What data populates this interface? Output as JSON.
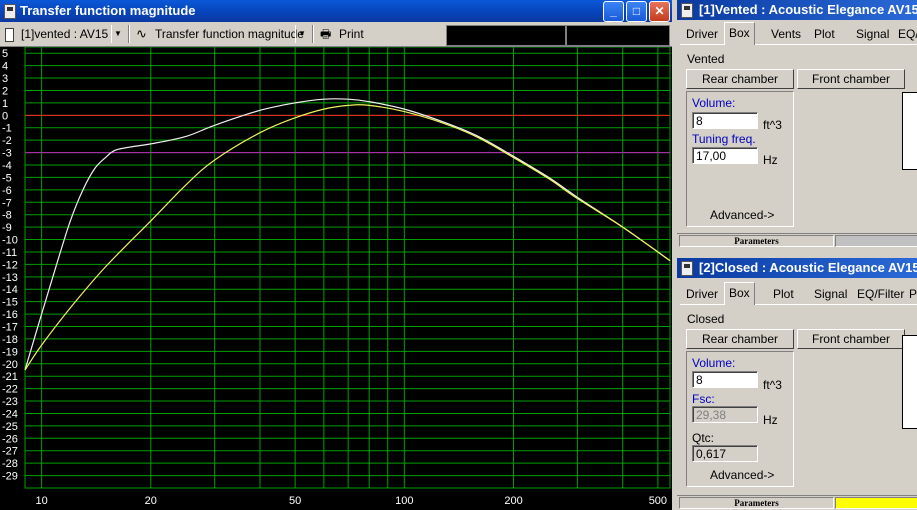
{
  "main_window": {
    "title": "Transfer function magnitude",
    "buttons": {
      "minimize": "_",
      "maximize": "□",
      "close": "✕"
    }
  },
  "toolbar": {
    "driver_select": "[1]vented : AV15",
    "plot_select": "Transfer function magnitude",
    "plot_icon": "sine-wave-icon",
    "print_label": "Print"
  },
  "chart_data": {
    "type": "line",
    "xscale": "log",
    "xlim": [
      9,
      540
    ],
    "ylim": [
      -30,
      5.5
    ],
    "grid": true,
    "y_ticks": [
      5,
      4,
      3,
      2,
      1,
      0,
      -1,
      -2,
      -3,
      -4,
      -5,
      -6,
      -7,
      -8,
      -9,
      -10,
      -11,
      -12,
      -13,
      -14,
      -15,
      -16,
      -17,
      -18,
      -19,
      -20,
      -21,
      -22,
      -23,
      -24,
      -25,
      -26,
      -27,
      -28,
      -29
    ],
    "x_tick_labels": [
      {
        "value": 10,
        "label": "10"
      },
      {
        "value": 20,
        "label": "20"
      },
      {
        "value": 50,
        "label": "50"
      },
      {
        "value": 100,
        "label": "100"
      },
      {
        "value": 200,
        "label": "200"
      },
      {
        "value": 500,
        "label": "500"
      }
    ],
    "reference_lines": [
      {
        "y": 0,
        "color": "#ff2020"
      },
      {
        "y": -3,
        "color": "#c020c0"
      }
    ],
    "series": [
      {
        "color": "#f0f0f0",
        "points": [
          [
            9,
            -20.5
          ],
          [
            10,
            -16
          ],
          [
            11,
            -12
          ],
          [
            12,
            -8.5
          ],
          [
            13,
            -6
          ],
          [
            14,
            -4.3
          ],
          [
            15,
            -3.4
          ],
          [
            16,
            -2.8
          ],
          [
            18,
            -2.5
          ],
          [
            20,
            -2.3
          ],
          [
            25,
            -1.7
          ],
          [
            30,
            -0.8
          ],
          [
            40,
            0.4
          ],
          [
            50,
            1.0
          ],
          [
            60,
            1.3
          ],
          [
            70,
            1.3
          ],
          [
            80,
            1.1
          ],
          [
            100,
            0.5
          ],
          [
            130,
            -0.6
          ],
          [
            160,
            -1.7
          ],
          [
            200,
            -3.3
          ],
          [
            250,
            -5.0
          ],
          [
            300,
            -6.6
          ],
          [
            400,
            -9.0
          ],
          [
            540,
            -11.7
          ]
        ]
      },
      {
        "color": "#f0f060",
        "points": [
          [
            9,
            -20.5
          ],
          [
            10,
            -18.5
          ],
          [
            12,
            -15.5
          ],
          [
            15,
            -12.2
          ],
          [
            20,
            -8.5
          ],
          [
            25,
            -5.6
          ],
          [
            30,
            -3.6
          ],
          [
            40,
            -1.4
          ],
          [
            50,
            -0.2
          ],
          [
            60,
            0.5
          ],
          [
            70,
            0.8
          ],
          [
            80,
            0.8
          ],
          [
            100,
            0.3
          ],
          [
            130,
            -0.7
          ],
          [
            160,
            -1.8
          ],
          [
            200,
            -3.4
          ],
          [
            250,
            -5.1
          ],
          [
            300,
            -6.7
          ],
          [
            400,
            -9.0
          ],
          [
            540,
            -11.7
          ]
        ]
      }
    ]
  },
  "panel_vented": {
    "title": "[1]Vented : Acoustic Elegance AV15",
    "tabs": [
      "Driver",
      "Box",
      "Vents",
      "Plot",
      "Signal",
      "EQ/"
    ],
    "active_tab": "Box",
    "box_type": "Vented",
    "rear_chamber": "Rear chamber",
    "front_chamber": "Front chamber",
    "volume_label": "Volume:",
    "volume_value": "8",
    "volume_unit": "ft^3",
    "tuning_label": "Tuning freq.",
    "tuning_value": "17,00",
    "tuning_unit": "Hz",
    "advanced": "Advanced->",
    "status": "Parameters"
  },
  "panel_closed": {
    "title": "[2]Closed : Acoustic Elegance AV15",
    "tabs": [
      "Driver",
      "Box",
      "Plot",
      "Signal",
      "EQ/Filter",
      "Pr"
    ],
    "active_tab": "Box",
    "box_type": "Closed",
    "rear_chamber": "Rear chamber",
    "front_chamber": "Front chamber",
    "volume_label": "Volume:",
    "volume_value": "8",
    "volume_unit": "ft^3",
    "fsc_label": "Fsc:",
    "fsc_value": "29,38",
    "fsc_unit": "Hz",
    "qtc_label": "Qtc:",
    "qtc_value": "0,617",
    "advanced": "Advanced->",
    "status": "Parameters",
    "status_color": "#ffff00"
  }
}
